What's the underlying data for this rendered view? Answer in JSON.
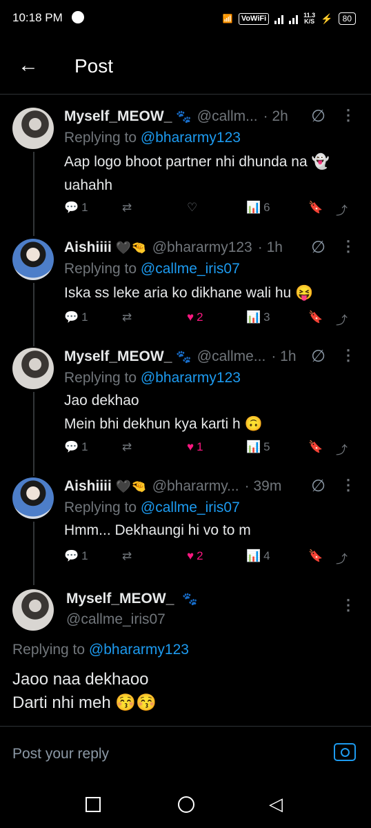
{
  "status_bar": {
    "time": "10:18 PM",
    "vowifi": "VoWiFi",
    "net_speed": "11.3",
    "net_unit": "K/S",
    "battery": "80"
  },
  "header": {
    "title": "Post"
  },
  "tweets": [
    {
      "name": "Myself_MEOW_",
      "emoji": "🐾",
      "handle": "@callm...",
      "time": "· 2h",
      "replying_prefix": "Replying to ",
      "replying_to": "@bhararmy123",
      "text_lines": [
        "Aap logo bhoot partner nhi dhunda na 👻",
        "uahahh"
      ],
      "replies": "1",
      "likes": "",
      "views": "6"
    },
    {
      "name": "Aishiiii",
      "emoji": "🖤🤏",
      "handle": "@bhararmy123",
      "time": "· 1h",
      "replying_prefix": "Replying to ",
      "replying_to": "@callme_iris07",
      "text_lines": [
        "Iska ss leke aria ko dikhane wali hu 😝"
      ],
      "replies": "1",
      "likes": "2",
      "views": "3"
    },
    {
      "name": "Myself_MEOW_",
      "emoji": "🐾",
      "handle": "@callme...",
      "time": "· 1h",
      "replying_prefix": "Replying to ",
      "replying_to": "@bhararmy123",
      "text_lines": [
        "Jao dekhao",
        "Mein bhi dekhun kya karti h 🙃"
      ],
      "replies": "1",
      "likes": "1",
      "views": "5"
    },
    {
      "name": "Aishiiii",
      "emoji": "🖤🤏",
      "handle": "@bhararmy...",
      "time": "· 39m",
      "replying_prefix": "Replying to ",
      "replying_to": "@callme_iris07",
      "text_lines": [
        "Hmm... Dekhaungi hi vo to m"
      ],
      "replies": "1",
      "likes": "2",
      "views": "4"
    }
  ],
  "focus": {
    "name": "Myself_MEOW_",
    "emoji": "🐾",
    "handle": "@callme_iris07",
    "replying_prefix": "Replying to ",
    "replying_to": "@bhararmy123",
    "text_lines": [
      "Jaoo naa dekhaoo",
      "Darti nhi meh 😚😚"
    ]
  },
  "reply_box": {
    "placeholder": "Post your reply"
  }
}
